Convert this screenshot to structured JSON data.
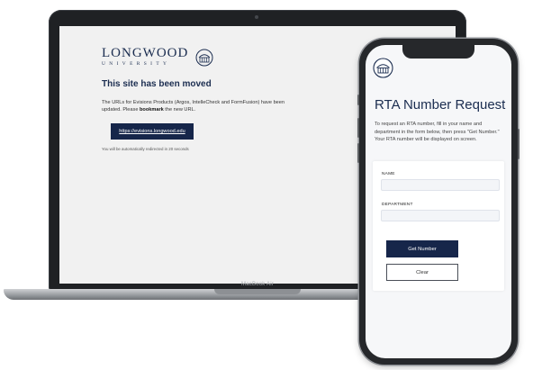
{
  "laptop": {
    "model_label": "MacBook Air",
    "site": {
      "logo_word": "LONGWOOD",
      "logo_sub": "UNIVERSITY",
      "title": "This site has been moved",
      "body_start": "The URLs for Evisions Products (Argos, IntelleCheck and FormFusion) have been updated. Please ",
      "body_bold": "bookmark",
      "body_end": " the new URL.",
      "link_label": "https://evisions.longwood.edu",
      "redirect_note": "You will be automatically redirected in 20 seconds"
    }
  },
  "phone": {
    "title": "RTA Number Request",
    "description": "To request an RTA number, fill in your name and department in the form below, then press \"Get Number.\" Your RTA number will be displayed on screen.",
    "form": {
      "name_label": "NAME",
      "name_value": "",
      "department_label": "DEPARTMENT",
      "department_value": "",
      "get_number_label": "Get Number",
      "clear_label": "Clear"
    }
  },
  "colors": {
    "brand_navy": "#16264a",
    "title_navy": "#1b2d50",
    "site_background": "#f1f1f1"
  },
  "icons": [
    "longwood-seal-icon",
    "phone-longwood-logo-icon"
  ]
}
